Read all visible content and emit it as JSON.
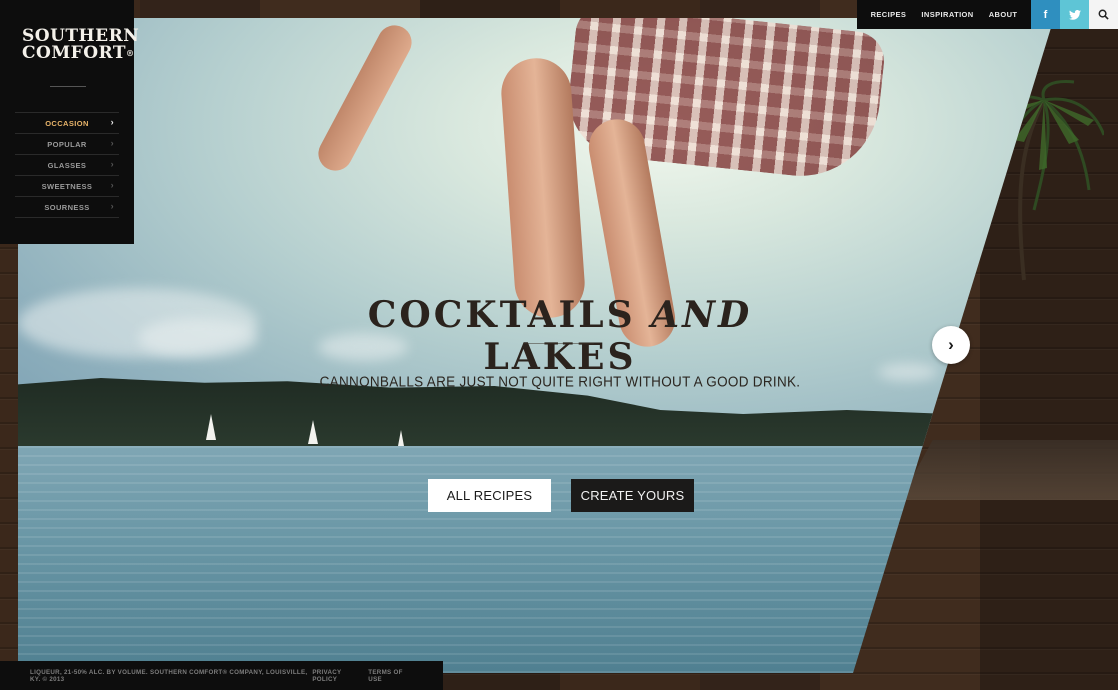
{
  "brand": {
    "logo_line1": "SOUTHERN",
    "logo_line2": "COMFORT",
    "logo_mark": "®"
  },
  "sidebar": {
    "items": [
      {
        "label": "OCCASION"
      },
      {
        "label": "POPULAR"
      },
      {
        "label": "GLASSES"
      },
      {
        "label": "SWEETNESS"
      },
      {
        "label": "SOURNESS"
      }
    ],
    "active_index": 0
  },
  "topnav": {
    "recipes": "RECIPES",
    "inspiration": "INSPIRATION",
    "about": "ABOUT",
    "facebook_glyph": "f",
    "twitter_glyph": "🐦",
    "search_glyph": "⌕"
  },
  "hero": {
    "title_part1": "COCKTAILS",
    "title_part2": "AND",
    "title_part3": "LAKES",
    "subtitle": "CANNONBALLS ARE JUST NOT QUITE RIGHT WITHOUT A GOOD DRINK.",
    "btn_all": "ALL RECIPES",
    "btn_create": "CREATE YOURS",
    "next_glyph": "›"
  },
  "footer": {
    "legal": "LIQUEUR, 21-50% ALC. BY VOLUME. SOUTHERN COMFORT® COMPANY, LOUISVILLE, KY. © 2013",
    "privacy": "PRIVACY POLICY",
    "terms": "TERMS OF USE"
  },
  "icons": {
    "chevron": "chevron-right-icon",
    "facebook": "facebook-icon",
    "twitter": "twitter-icon",
    "search": "search-icon",
    "next": "arrow-right-icon"
  },
  "colors": {
    "accent": "#e8b46a",
    "facebook": "#2f8fbf",
    "twitter": "#5ec5d6",
    "dark": "#0d0d0d"
  }
}
